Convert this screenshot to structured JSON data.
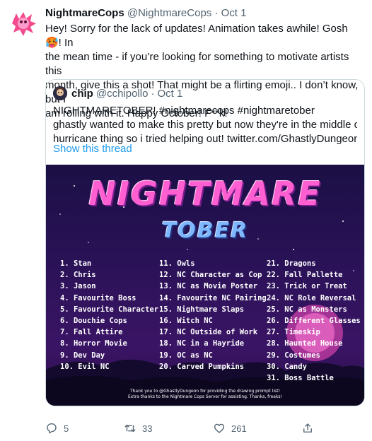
{
  "tweet": {
    "name": "NightmareCops",
    "handle": "@NightmareCops",
    "date": "Oct 1",
    "text_lines": [
      "Hey! Sorry for the lack of updates! Animation takes awhile! Gosh 🥵! In",
      "the mean time - if you’re looking for something to motivate artists this",
      "month, give this a shot! That might be a flirting emoji.. I don’t know, but I",
      "am rolling with it. Happy October! F**k!"
    ]
  },
  "quote": {
    "name": "chip",
    "handle": "@cchipollo",
    "date": "Oct 1",
    "text_lines": [
      "NIGHTMARETOBER! #nightmarecops #nightmaretober",
      "ghastly wanted to make this pretty but now they're in the middle of a",
      "hurricane thing so i tried helping out!  twitter.com/GhastlyDungeon..."
    ],
    "show_thread": "Show this thread"
  },
  "poster": {
    "title_top": "NIGHTMARE",
    "title_bottom": "TOBER",
    "column1": [
      "1. Stan",
      "2. Chris",
      "3. Jason",
      "4. Favourite Boss",
      "5. Favourite Character",
      "6. Douchie Cops",
      "7. Fall Attire",
      "8. Horror Movie",
      "9. Dev Day",
      "10. Evil NC"
    ],
    "column2": [
      "11. Owls",
      "12. NC Character as Cop",
      "13. NC as Movie Poster",
      "14. Favourite NC Pairing",
      "15. Nightmare Slaps",
      "16. Witch NC",
      "17. NC Outside of Work",
      "18. NC in a Hayride",
      "19. OC as NC",
      "20. Carved Pumpkins"
    ],
    "column3": [
      "21. Dragons",
      "22. Fall Pallette",
      "23. Trick or Treat",
      "24. NC Role Reversal",
      "25. NC as Monsters",
      "26. Different Glasses",
      "27. Timeskip",
      "28. Haunted House",
      "29. Costumes",
      "30. Candy",
      "31. Boss Battle"
    ],
    "credit1": "Thank you to @GhastlyDungeon for providing the drawing prompt list!",
    "credit2": "Extra thanks to the Nightmare Cops Server for assisting. Thanks, freaks!"
  },
  "actions": {
    "replies": "5",
    "retweets": "33",
    "likes": "261"
  }
}
